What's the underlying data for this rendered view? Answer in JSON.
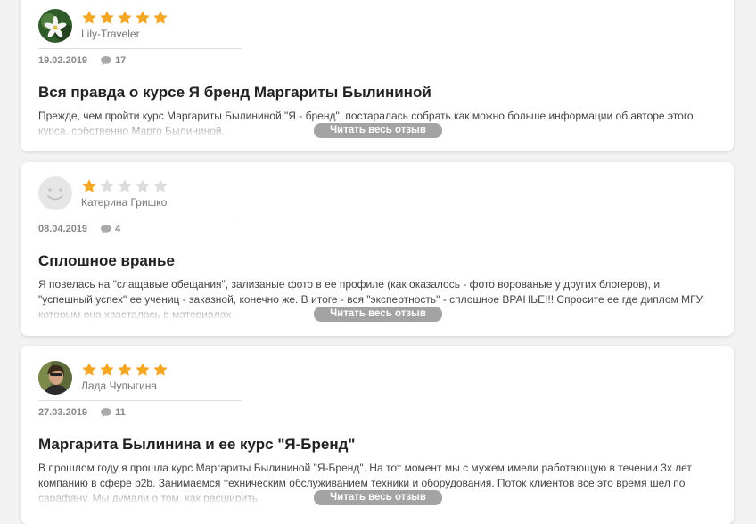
{
  "reviews": [
    {
      "author": "Lily-Traveler",
      "rating": 5,
      "date": "19.02.2019",
      "comments": "17",
      "title": "Вся правда о курсе Я бренд Маргариты Былининой",
      "excerpt": "Прежде, чем пройти курс Маргариты Былининой \"Я - бренд\", постаралась собрать как можно больше информации об авторе этого курса, собственно Марго Былининой.",
      "read_more": "Читать весь отзыв"
    },
    {
      "author": "Катерина Гришко",
      "rating": 1,
      "date": "08.04.2019",
      "comments": "4",
      "title": "Сплошное вранье",
      "excerpt": "Я повелась на \"слащавые обещания\", зализаные фото в ее профиле (как оказалось - фото ворованые у других блогеров), и \"успешный успех\" ее учениц - заказной, конечно же.   В итоге - вся \"экспертность\" - сплошное ВРАНЬЕ!!! Спросите ее где диплом МГУ, которым она хвасталась в материалах",
      "read_more": "Читать весь отзыв"
    },
    {
      "author": "Лада Чупыгина",
      "rating": 5,
      "date": "27.03.2019",
      "comments": "11",
      "title": "Маргарита Былинина и ее курс \"Я-Бренд\"",
      "excerpt": "В прошлом году я прошла курс Маргариты Былининой \"Я-Бренд\". На тот момент мы с мужем имели работающую в течении 3х лет компанию в сфере b2b. Занимаемся техническим обслуживанием техники и оборудования.   Поток клиентов все это время шел по сарафану. Мы думали о том, как расширить",
      "read_more": "Читать весь отзыв"
    }
  ],
  "colors": {
    "star_filled": "#f5a623",
    "star_empty": "#dddddd",
    "button_bg": "#a3a3a3"
  }
}
